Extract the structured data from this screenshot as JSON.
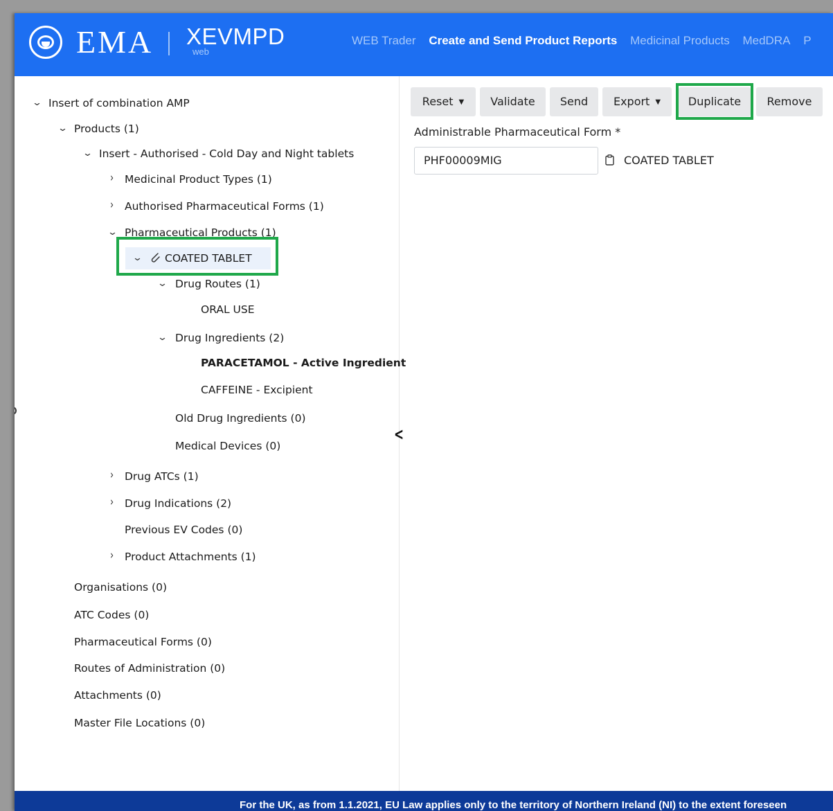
{
  "header": {
    "logo_text": "EMA",
    "product_name": "XEVMPD",
    "product_sub": "web",
    "nav": [
      {
        "label": "WEB Trader",
        "active": false
      },
      {
        "label": "Create and Send Product Reports",
        "active": true
      },
      {
        "label": "Medicinal Products",
        "active": false
      },
      {
        "label": "MedDRA",
        "active": false
      },
      {
        "label": "P",
        "active": false
      }
    ]
  },
  "tree": {
    "root": "Insert of combination AMP",
    "products": "Products (1)",
    "insert": "Insert - Authorised - Cold Day and Night tablets",
    "medicinal_product_types": "Medicinal Product Types (1)",
    "authorised_forms": "Authorised Pharmaceutical Forms (1)",
    "pharma_products": "Pharmaceutical Products (1)",
    "coated_tablet": "COATED TABLET",
    "drug_routes": "Drug Routes (1)",
    "oral_use": "ORAL USE",
    "drug_ingredients": "Drug Ingredients (2)",
    "paracetamol": "PARACETAMOL - Active Ingredient",
    "caffeine": "CAFFEINE - Excipient",
    "old_drug_ingredients": "Old Drug Ingredients (0)",
    "medical_devices": "Medical Devices (0)",
    "drug_atcs": "Drug ATCs (1)",
    "drug_indications": "Drug Indications (2)",
    "previous_ev_codes": "Previous EV Codes (0)",
    "product_attachments": "Product Attachments (1)",
    "organisations": "Organisations (0)",
    "atc_codes": "ATC Codes (0)",
    "pharmaceutical_forms": "Pharmaceutical Forms (0)",
    "routes_of_administration": "Routes of Administration (0)",
    "attachments": "Attachments (0)",
    "master_file_locations": "Master File Locations (0)"
  },
  "toolbar": {
    "reset": "Reset",
    "validate": "Validate",
    "send": "Send",
    "export": "Export",
    "duplicate": "Duplicate",
    "remove": "Remove"
  },
  "form": {
    "label": "Administrable Pharmaceutical Form *",
    "code_value": "PHF00009MIG",
    "term_value": "COATED TABLET"
  },
  "footer": {
    "text": "For the UK, as from 1.1.2021, EU Law applies only to the territory of Northern Ireland (NI) to the extent foreseen"
  },
  "colors": {
    "header_bg": "#1d6ff2",
    "footer_bg": "#0d3a98",
    "highlight": "#1fa84a"
  }
}
